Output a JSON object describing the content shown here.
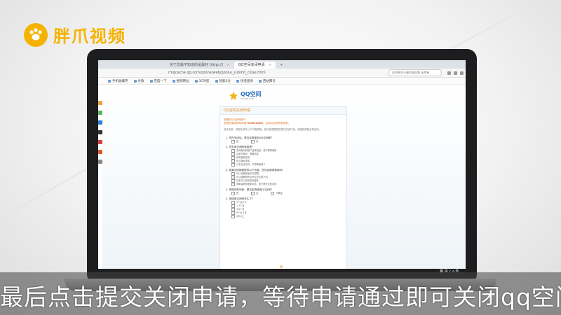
{
  "watermark": {
    "brand": "胖爪视频"
  },
  "browser": {
    "tabs": [
      {
        "label": "关于您最不知道的是最好 [http://]",
        "active": false
      },
      {
        "label": "QQ空间关闭申请",
        "active": true
      }
    ],
    "address": "rmgcache.qq.com/qzone/web/qzone_submit_close.html",
    "search_placeholder": "金控贵宾卡服务器全集 高考卷",
    "bookmarks": [
      "手机收藏夹",
      "谷歌",
      "百度一下",
      "搜狗网址",
      "3C导航",
      "智能2分",
      "快递查询",
      "西站网页"
    ]
  },
  "page": {
    "logo_title": "QQ空间",
    "logo_sub": "QZONE.COM",
    "card_title": "QQ空间关闭申请",
    "notice_line1": "亲爱的QQ空间用户:",
    "notice_line2_prefix": "您现在使用的号码是",
    "notice_number": "645618006",
    "notice_line2_suffix": "，空间以后的所有资料。",
    "intro": "在关闭前，请您先填写以下问卷调查，我们会根据您的意见改进产品，谢谢您的配合和支持。",
    "questions": [
      {
        "title": "1. 您在关闭后，是否会再使用QQ空间呢？",
        "inline": [
          "是",
          "否"
        ]
      },
      {
        "title": "2. 您关闭空间的原因是？",
        "options": [
          "空间相对其他产品体验差，我不想再使用",
          "功能不够好，需要改善",
          "我有其他空间",
          "担心隐私泄露",
          "日志无法访问，不想再使用了"
        ]
      },
      {
        "title": "3. 如果空间能够提供以下功能，您还会继续使用吗？",
        "options": [
          "可以设置其他访问权限",
          "可以隐藏我的空间让好友看不到",
          "好友可以在我空间留言",
          "我希望看到更新动态，而不是好友的动态"
        ]
      },
      {
        "title": "4. 您现在的年龄，是否会再使用QQ空间？",
        "inline": [
          "是",
          "否",
          "不确定"
        ]
      },
      {
        "title": "5. 您使用空间有多久了？",
        "options": [
          "1个月以下",
          "1-3个月",
          "3-6个月",
          "6个月-1年",
          "1年以上"
        ]
      }
    ]
  },
  "taskbar": {
    "tray": "英 中 ♪ ⌂ 🔍"
  },
  "subtitle": "最后点击提交关闭申请，等待申请通过即可关闭qq空间"
}
